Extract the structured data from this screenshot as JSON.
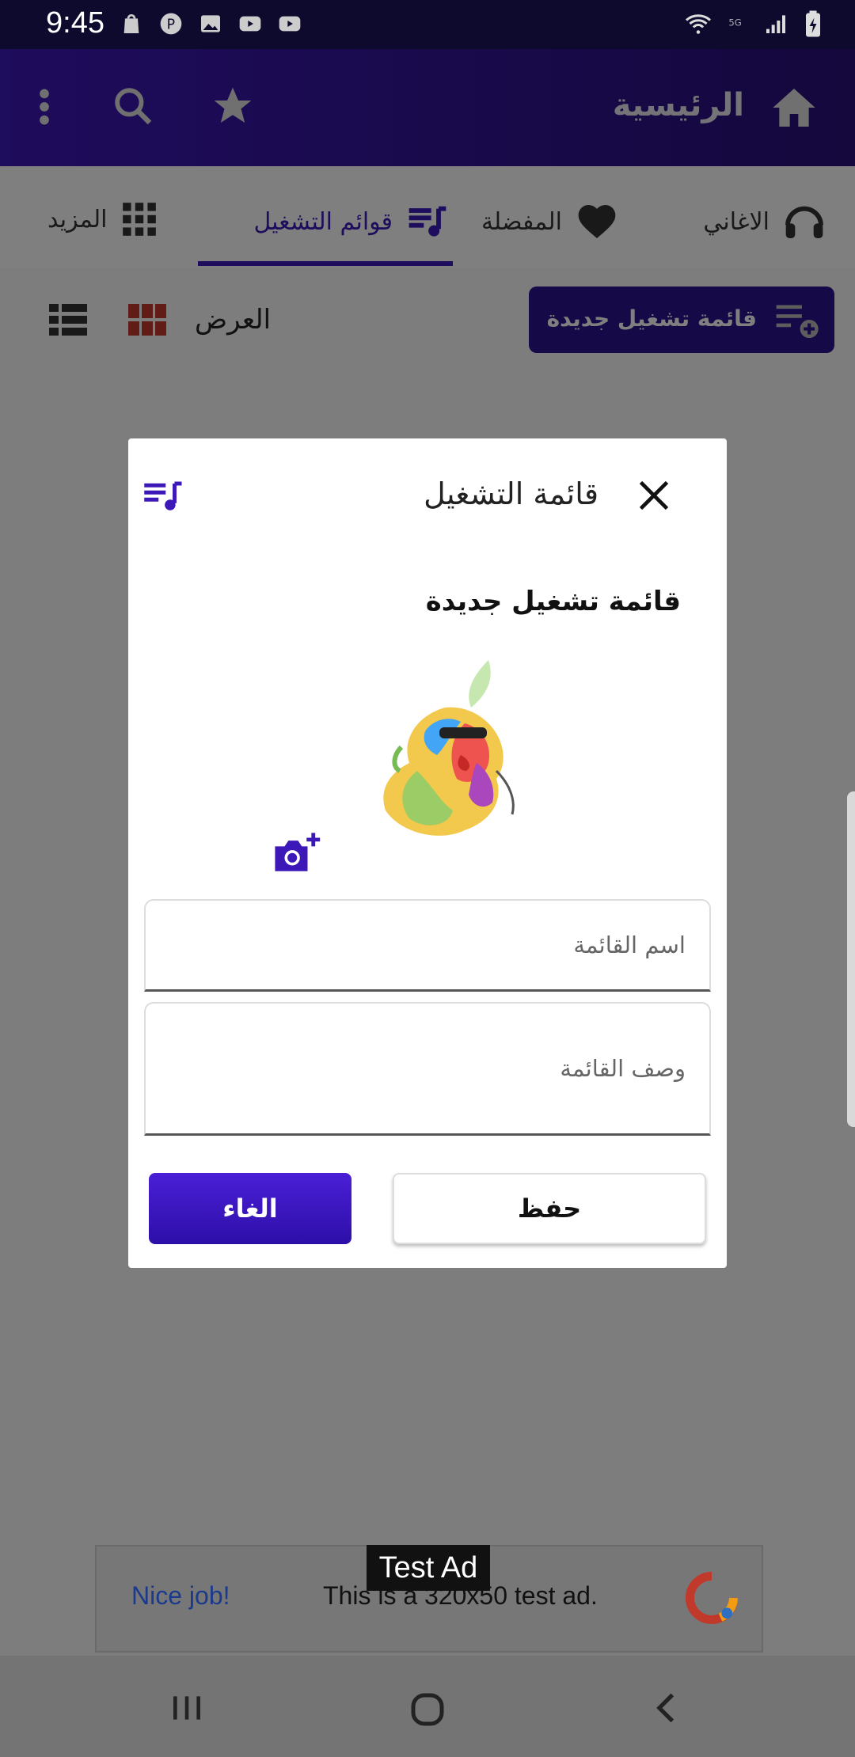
{
  "status": {
    "time": "9:45"
  },
  "appbar": {
    "title": "الرئيسية"
  },
  "tabs": [
    {
      "label": "الاغاني",
      "icon": "headphones-icon"
    },
    {
      "label": "المفضلة",
      "icon": "heart-icon"
    },
    {
      "label": "قوائم التشغيل",
      "icon": "playlist-icon"
    },
    {
      "label": "المزيد",
      "icon": "grid-icon"
    }
  ],
  "toolbar": {
    "new_playlist": "قائمة تشغيل جديدة",
    "view_label": "العرض"
  },
  "dialog": {
    "title": "قائمة التشغيل",
    "subtitle": "قائمة تشغيل جديدة",
    "name_placeholder": "اسم القائمة",
    "desc_placeholder": "وصف القائمة",
    "save_label": "حفظ",
    "cancel_label": "الغاء"
  },
  "ad": {
    "badge": "Test Ad",
    "nice": "Nice job!",
    "text": "This is a 320x50 test ad."
  },
  "colors": {
    "primary": "#3d18b8",
    "status_bar": "#0d0a2e",
    "overlay": "rgba(0,0,0,0.5)"
  }
}
